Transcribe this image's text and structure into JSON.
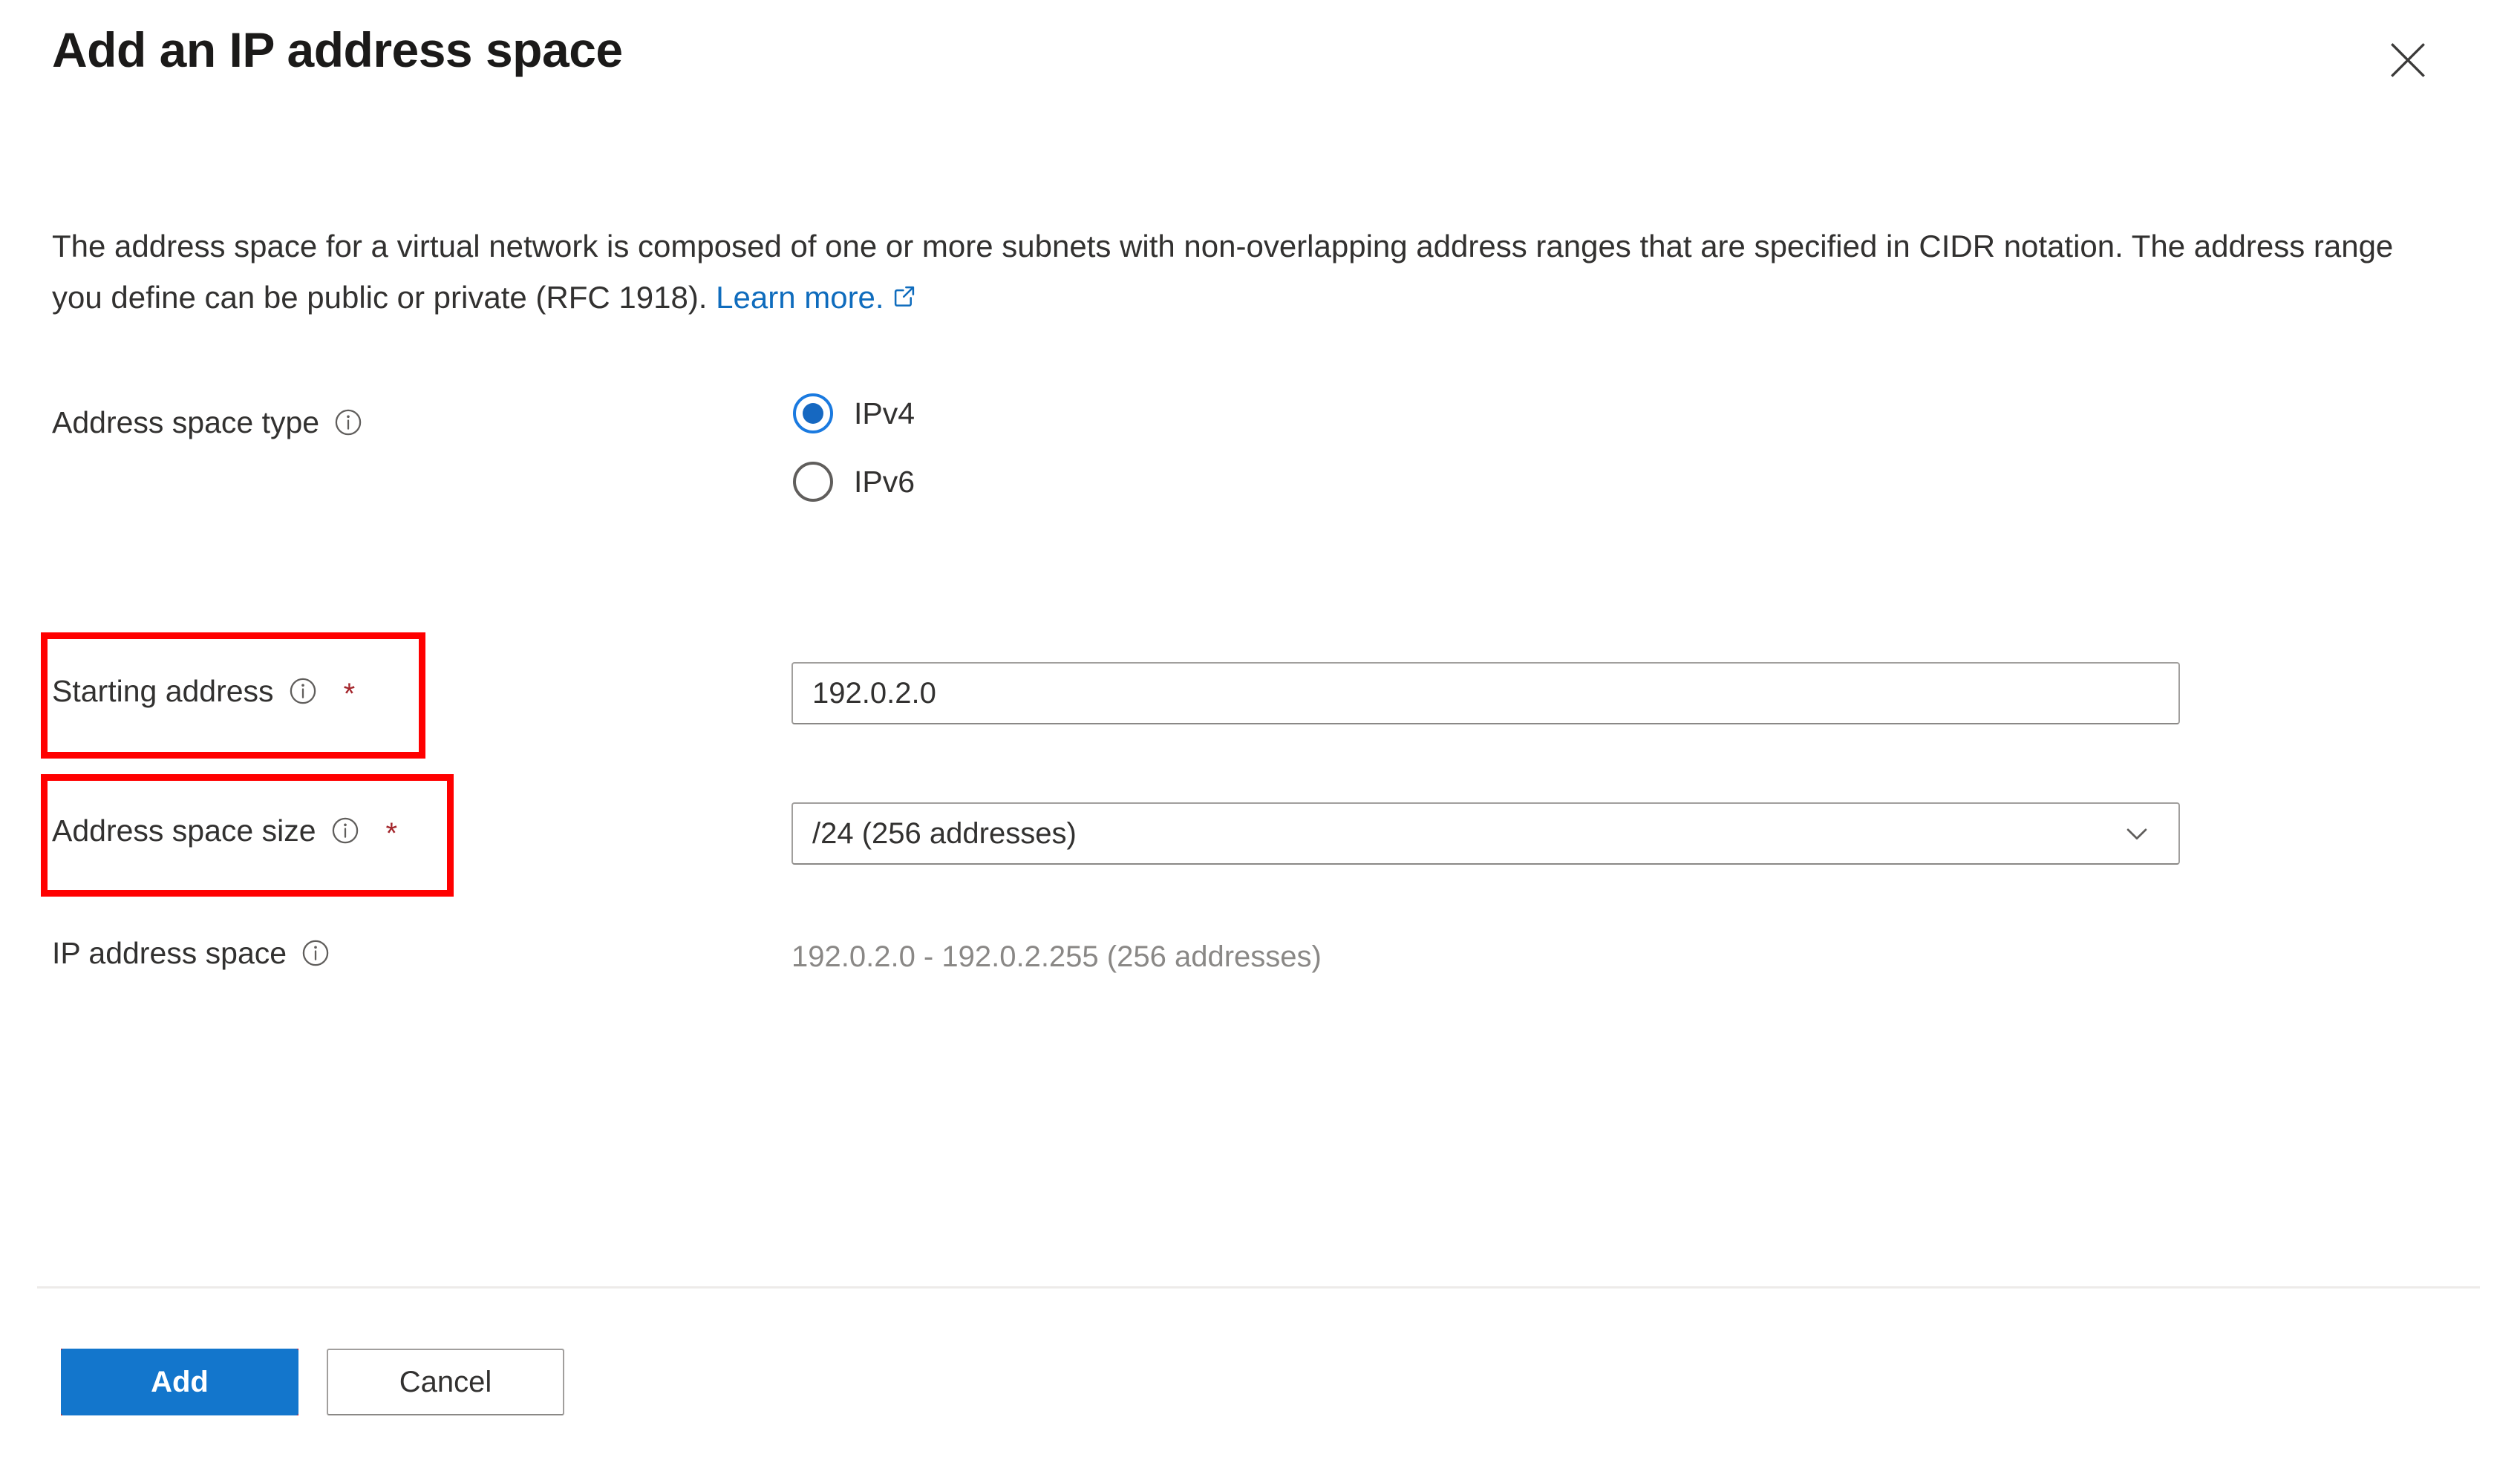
{
  "header": {
    "title": "Add an IP address space",
    "close_icon": "close-icon"
  },
  "description": {
    "text_before_link": "The address space for a virtual network is composed of one or more subnets with non-overlapping address ranges that are specified in CIDR notation. The address range you define can be public or private (RFC 1918). ",
    "link_label": "Learn more.",
    "link_icon": "external-link-icon"
  },
  "fields": {
    "address_space_type": {
      "label": "Address space type",
      "info_icon": "info-icon",
      "options": [
        {
          "label": "IPv4",
          "selected": true
        },
        {
          "label": "IPv6",
          "selected": false
        }
      ]
    },
    "starting_address": {
      "label": "Starting address",
      "info_icon": "info-icon",
      "required_marker": "*",
      "value": "192.0.2.0",
      "placeholder": "192.0.2.0",
      "highlighted": true
    },
    "address_space_size": {
      "label": "Address space size",
      "info_icon": "info-icon",
      "required_marker": "*",
      "value": "/24 (256 addresses)",
      "chevron_icon": "chevron-down-icon",
      "highlighted": true
    },
    "ip_address_space": {
      "label": "IP address space",
      "info_icon": "info-icon",
      "value": "192.0.2.0 - 192.0.2.255 (256 addresses)"
    }
  },
  "footer": {
    "add_label": "Add",
    "cancel_label": "Cancel"
  },
  "colors": {
    "accent": "#1376cc",
    "link": "#0f6cbd",
    "highlight": "#ff0000",
    "required": "#a4262c"
  }
}
